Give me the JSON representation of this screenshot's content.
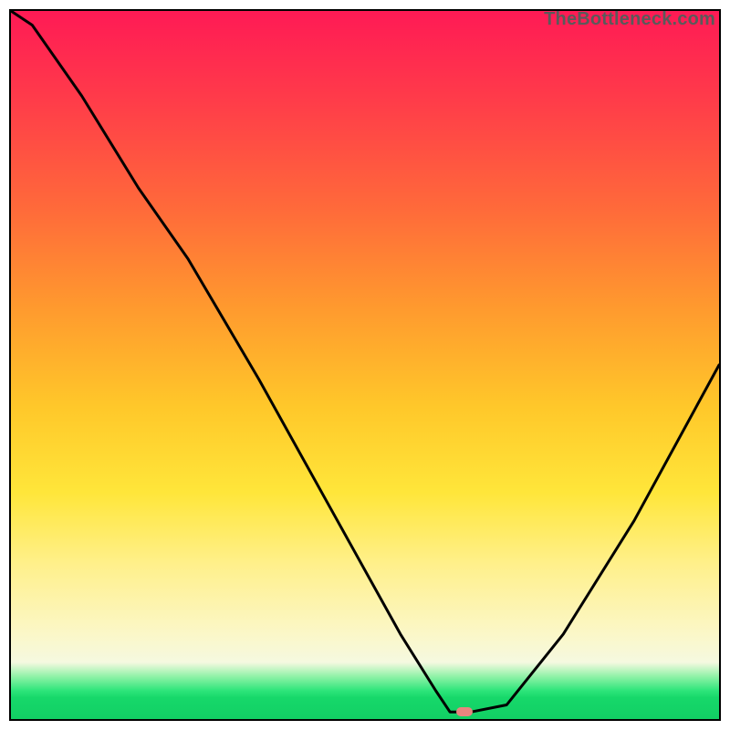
{
  "watermark": "TheBottleneck.com",
  "chart_data": {
    "type": "line",
    "title": "",
    "xlabel": "",
    "ylabel": "",
    "xlim": [
      0,
      100
    ],
    "ylim": [
      0,
      100
    ],
    "grid": false,
    "legend": false,
    "series": [
      {
        "name": "bottleneck-curve",
        "x": [
          0,
          3,
          10,
          18,
          25,
          35,
          45,
          55,
          60,
          62,
          65,
          70,
          78,
          88,
          100
        ],
        "y": [
          100,
          98,
          88,
          75,
          65,
          48,
          30,
          12,
          4,
          1,
          1,
          2,
          12,
          28,
          50
        ]
      }
    ],
    "marker": {
      "x": 64,
      "y": 1,
      "label": "optimal-point"
    },
    "background_gradient": {
      "top": "#ff1a55",
      "mid": "#ffd23a",
      "bottom": "#12cf64"
    }
  }
}
